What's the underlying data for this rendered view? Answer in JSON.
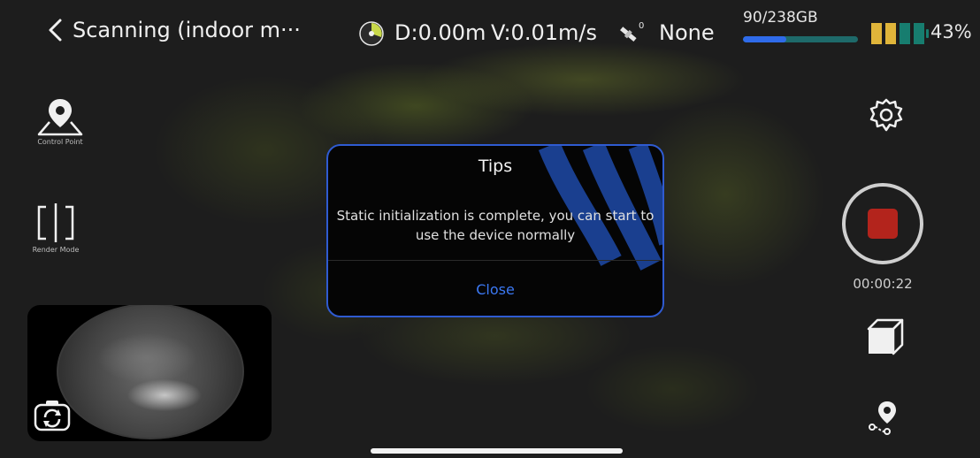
{
  "header": {
    "title": "Scanning (indoor m···",
    "distance": "D:0.00m",
    "velocity": "V:0.01m/s",
    "satellite_count": "0",
    "gnss_status": "None",
    "storage_text": "90/238GB",
    "storage_used_fraction": 0.378,
    "battery_percent": "43%",
    "battery_level": 0.43
  },
  "left_toolbar": {
    "control_point_label": "Control Point",
    "render_mode_label": "Render Mode"
  },
  "dialog": {
    "title": "Tips",
    "message": "Static initialization is complete, you can start to use the device normally",
    "close_label": "Close"
  },
  "right_toolbar": {
    "timer": "00:00:22"
  },
  "colors": {
    "accent_blue": "#2f5bd1",
    "record_red": "#b3241c",
    "battery_yellow": "#e0b53a",
    "battery_green": "#177d6f"
  },
  "icons": [
    "back-chevron-icon",
    "speed-dial-icon",
    "satellite-icon",
    "battery-icon",
    "map-pin-icon",
    "render-mode-icon",
    "switch-camera-icon",
    "gear-icon",
    "record-icon",
    "cube-view-icon",
    "route-pin-icon"
  ]
}
